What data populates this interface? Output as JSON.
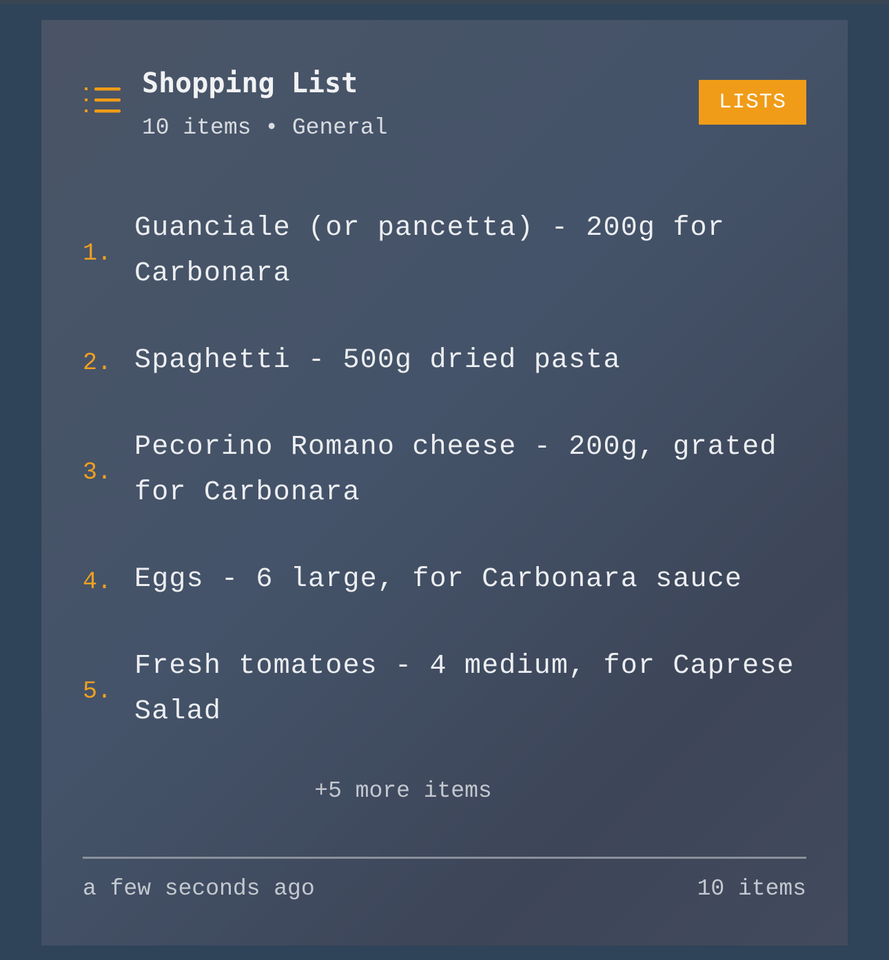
{
  "header": {
    "title": "Shopping List",
    "subtitle": "10 items • General",
    "lists_button_label": "LISTS",
    "icon": "list-icon"
  },
  "items": [
    {
      "number": "1.",
      "text": "Guanciale (or pancetta) - 200g for Carbonara"
    },
    {
      "number": "2.",
      "text": "Spaghetti - 500g dried pasta"
    },
    {
      "number": "3.",
      "text": "Pecorino Romano cheese - 200g, grated for Carbonara"
    },
    {
      "number": "4.",
      "text": "Eggs - 6 large, for Carbonara sauce"
    },
    {
      "number": "5.",
      "text": "Fresh tomatoes - 4 medium, for Caprese Salad"
    }
  ],
  "more_items": "+5 more items",
  "footer": {
    "timestamp": "a few seconds ago",
    "count": "10 items"
  },
  "colors": {
    "page_background": "#2f4359",
    "card_background": "#445369",
    "accent": "#f09c18",
    "text": "#eceef1"
  }
}
